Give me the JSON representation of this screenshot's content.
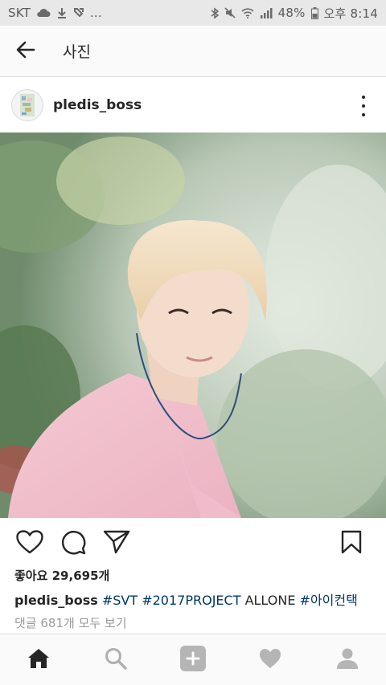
{
  "status_bar": {
    "carrier": "SKT",
    "more_indicator": "...",
    "battery": "48%",
    "time": "오후 8:14",
    "icons": [
      "cloud-icon",
      "download-icon",
      "app-notification-icon",
      "bluetooth-icon",
      "mute-icon",
      "wifi-icon",
      "signal-icon",
      "battery-icon"
    ]
  },
  "app_bar": {
    "title": "사진",
    "back_icon": "back-arrow-icon"
  },
  "post": {
    "username": "pledis_boss",
    "more_icon": "more-vertical-icon",
    "likes_text": "좋아요 29,695개",
    "caption": {
      "username": "pledis_boss",
      "tags_1": "#SVT #2017PROJECT",
      "plain": "ALLONE",
      "tags_2": "#아이컨택"
    },
    "comments_text": "댓글 681개 모두 보기",
    "action_icons": [
      "heart-icon",
      "comment-icon",
      "share-icon",
      "bookmark-icon"
    ]
  },
  "bottom_nav": {
    "items": [
      {
        "name": "home",
        "icon": "home-icon",
        "active": true
      },
      {
        "name": "search",
        "icon": "search-icon",
        "active": false
      },
      {
        "name": "add",
        "icon": "add-post-icon",
        "active": false
      },
      {
        "name": "activity",
        "icon": "heart-icon",
        "active": false
      },
      {
        "name": "profile",
        "icon": "profile-icon",
        "active": false
      }
    ]
  },
  "colors": {
    "text": "#262626",
    "hashtag": "#003569",
    "muted": "#999999",
    "status_bar": "#e8e8e8"
  }
}
